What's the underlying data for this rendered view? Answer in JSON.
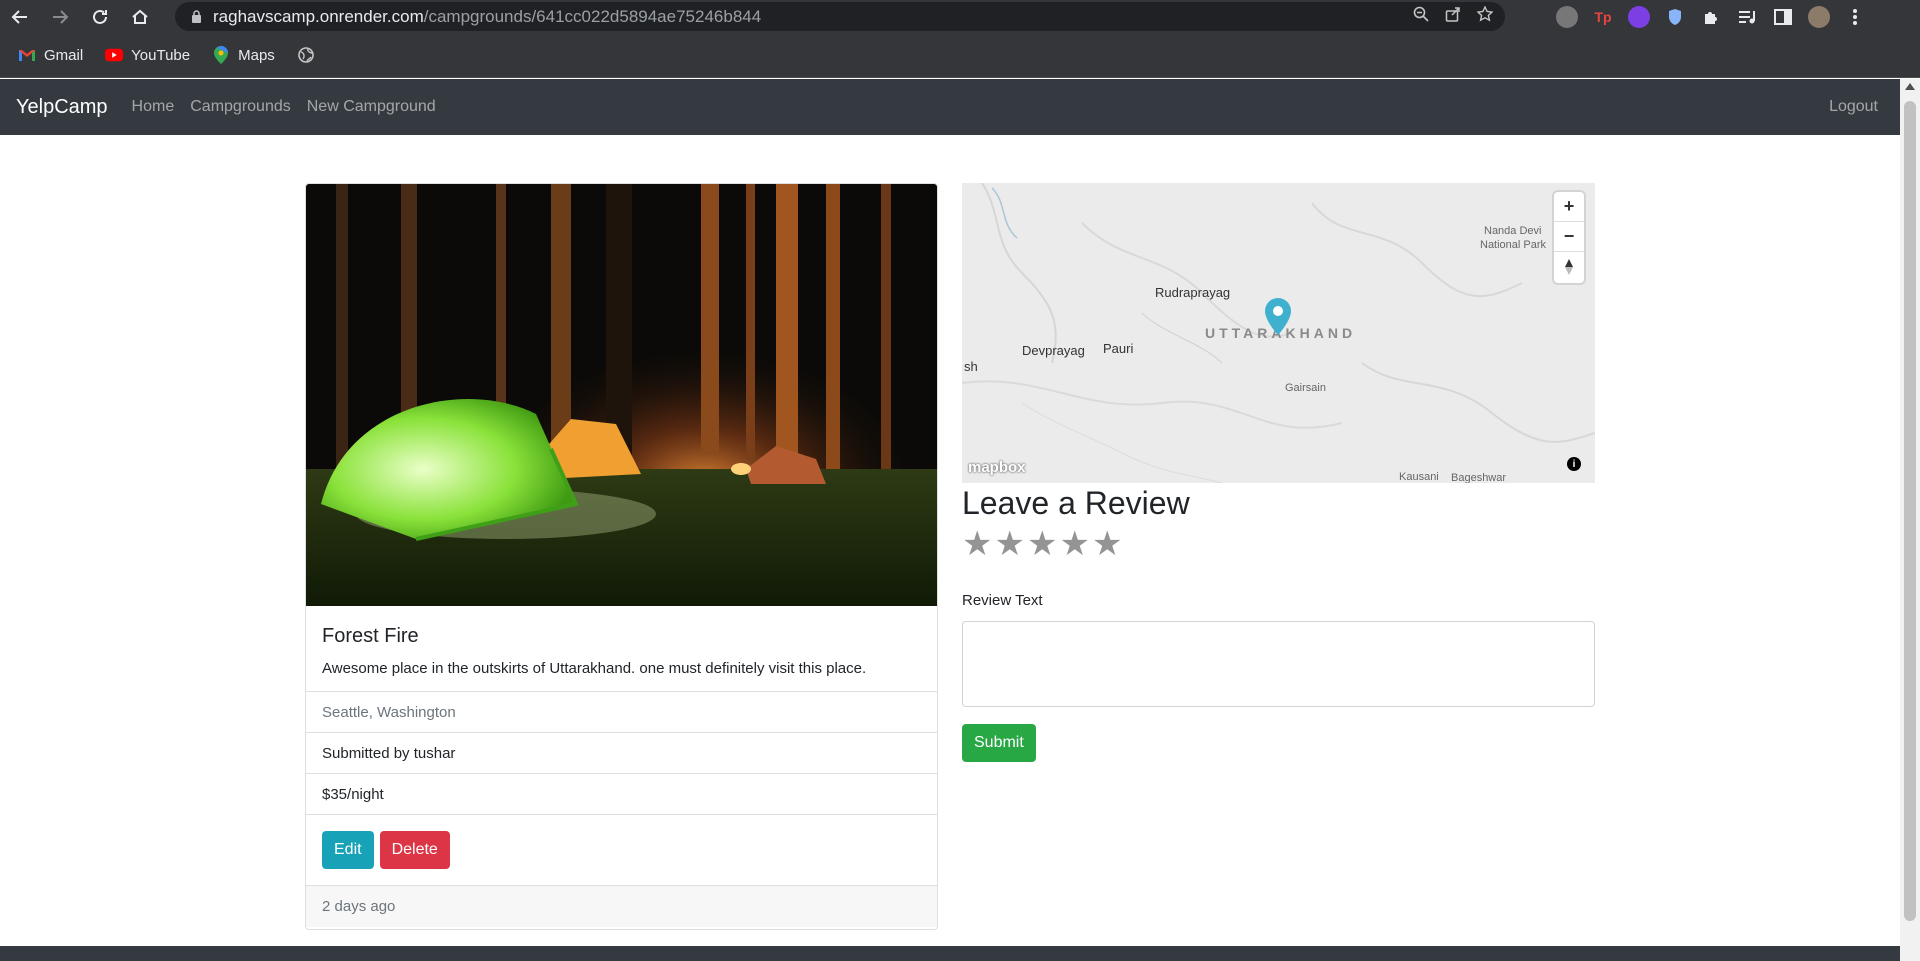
{
  "browser": {
    "url_host": "raghavscamp.onrender.com",
    "url_path": "/campgrounds/641cc022d5894ae75246b844",
    "bookmarks": [
      {
        "label": "Gmail",
        "icon": "gmail-icon"
      },
      {
        "label": "YouTube",
        "icon": "youtube-icon"
      },
      {
        "label": "Maps",
        "icon": "maps-icon"
      }
    ],
    "extensions": [
      "ext-grey-icon",
      "tp-icon",
      "purple-shield-icon",
      "shield-icon",
      "puzzle-icon",
      "media-icon",
      "sidepanel-icon",
      "profile-avatar",
      "menu-icon"
    ],
    "ext_tp_label": "Tp"
  },
  "navbar": {
    "brand": "YelpCamp",
    "links": [
      "Home",
      "Campgrounds",
      "New Campground"
    ],
    "logout": "Logout"
  },
  "campground": {
    "title": "Forest Fire",
    "description": "Awesome place in the outskirts of Uttarakhand. one must definitely visit this place.",
    "location": "Seattle, Washington",
    "submitted_by": "Submitted by tushar",
    "price": "$35/night",
    "edit_label": "Edit",
    "delete_label": "Delete",
    "posted": "2 days ago"
  },
  "map": {
    "labels": {
      "rudraprayag": "Rudraprayag",
      "uttarakhand": "UTTARAKHAND",
      "devprayag": "Devprayag",
      "pauri": "Pauri",
      "gairsain": "Gairsain",
      "sh": "sh",
      "nanda_devi_1": "Nanda Devi",
      "nanda_devi_2": "National Park",
      "kausani": "Kausani",
      "bageshwar": "Bageshwar"
    },
    "zoom_in": "+",
    "zoom_out": "−",
    "attribution_logo": "mapbox",
    "pin_color": "#3fb1ce"
  },
  "review": {
    "heading": "Leave a Review",
    "star_count": 5,
    "stars_selected": 0,
    "text_label": "Review Text",
    "text_value": "",
    "submit_label": "Submit"
  },
  "colors": {
    "navbar": "#343a40",
    "info": "#17a2b8",
    "danger": "#dc3545",
    "success": "#28a745"
  }
}
